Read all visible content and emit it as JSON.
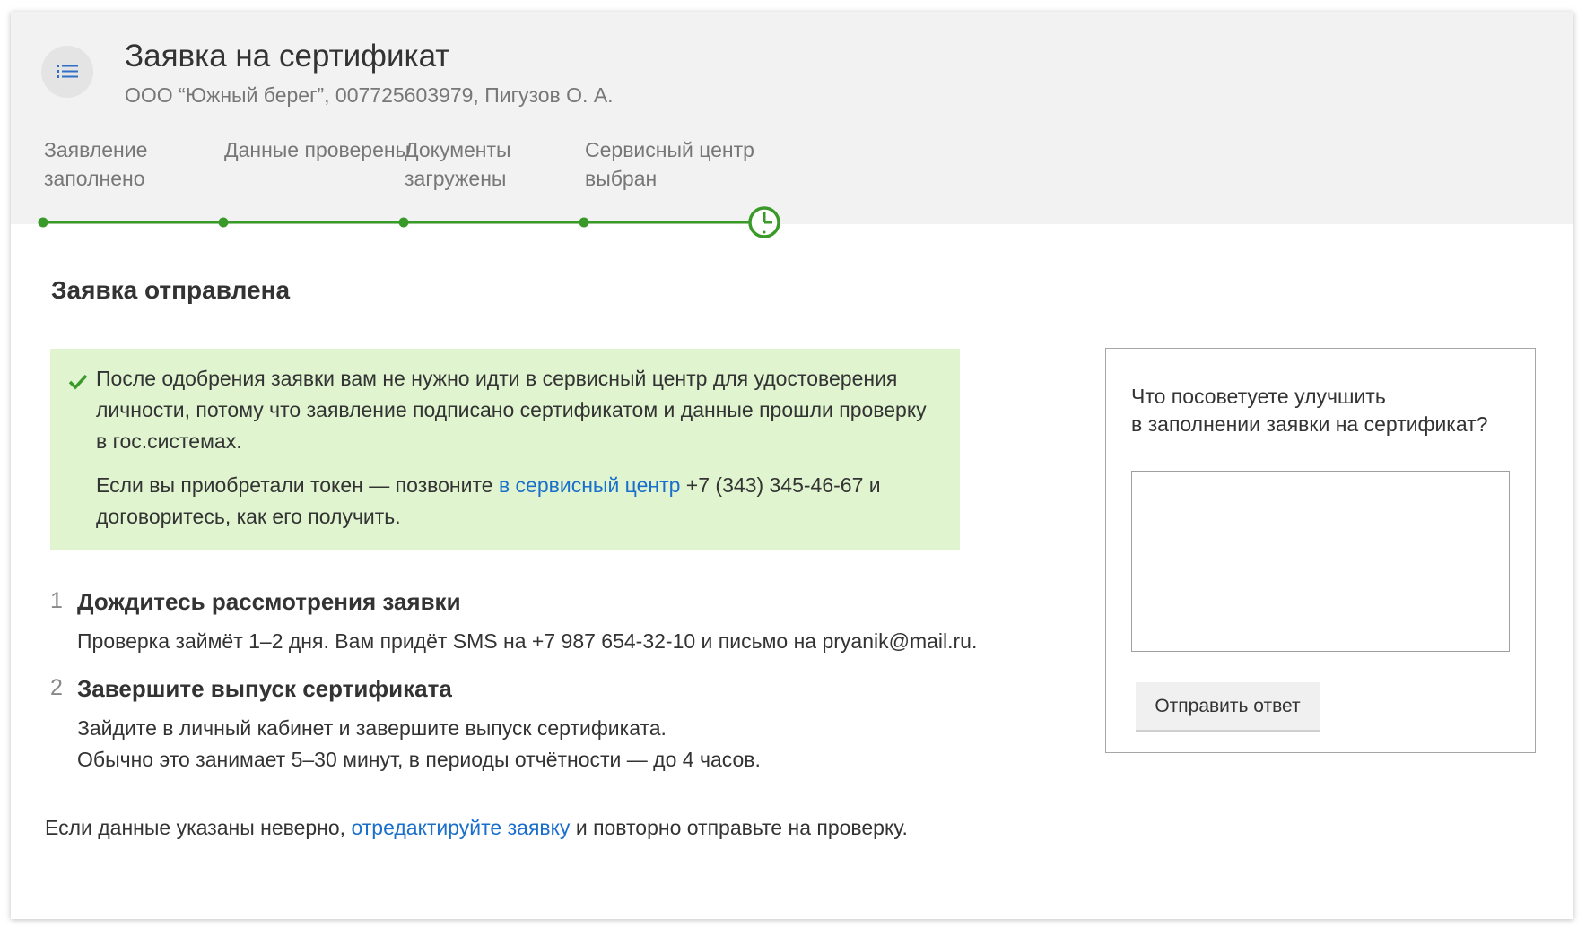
{
  "header": {
    "title": "Заявка на сертификат",
    "subtitle": "ООО “Южный берег”, 007725603979, Пигузов О. А.",
    "menu_icon": "list-icon"
  },
  "progress": {
    "steps": [
      {
        "label": "Заявление заполнено",
        "status": "done"
      },
      {
        "label": "Данные проверены",
        "status": "done"
      },
      {
        "label": "Документы загружены",
        "status": "done"
      },
      {
        "label": "Сервисный центр выбран",
        "status": "done"
      },
      {
        "label": "",
        "status": "pending",
        "icon": "clock-icon"
      }
    ],
    "color": "#3a9a29"
  },
  "main": {
    "title": "Заявка отправлена",
    "notice": {
      "icon": "checkmark-icon",
      "text1": "После одобрения заявки вам не нужно идти в сервисный центр для удостоверения личности, потому что заявление подписано сертификатом и данные прошли проверку в гос.системах.",
      "text2_before": "Если вы приобретали токен — позвоните ",
      "text2_link": "в сервисный центр",
      "text2_after": " +7 (343) 345-46-67 и договоритесь, как его получить.",
      "background": "#dff4cf"
    },
    "steps": [
      {
        "number": "1",
        "title": "Дождитесь рассмотрения заявки",
        "body": "Проверка займёт 1–2 дня.  Вам придёт SMS на +7 987 654-32-10 и письмо на pryanik@mail.ru."
      },
      {
        "number": "2",
        "title": "Завершите выпуск сертификата",
        "body_line1": "Зайдите в личный кабинет и завершите выпуск сертификата.",
        "body_line2": "Обычно это занимает 5–30 минут, в периоды отчётности — до 4 часов."
      }
    ],
    "footer": {
      "before": "Если данные указаны неверно, ",
      "link": "отредактируйте заявку",
      "after": " и повторно отправьте на проверку."
    }
  },
  "feedback": {
    "question_line1": "Что посоветуете улучшить",
    "question_line2": "в заполнении заявки на сертификат?",
    "answer_value": "",
    "submit_label": "Отправить ответ"
  },
  "colors": {
    "link": "#1a6fcc",
    "accent_green": "#3a9a29",
    "header_bg": "#f2f2f2"
  }
}
